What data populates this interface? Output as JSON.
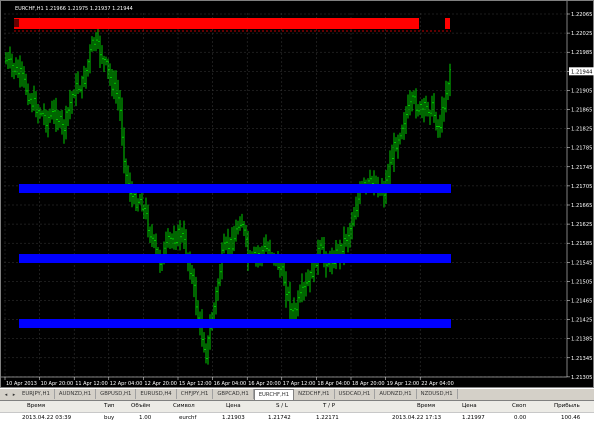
{
  "chart": {
    "title": "EURCHF,H1  1.21966 1.21975 1.21937 1.21944",
    "price_axis": [
      "1.22065",
      "1.22025",
      "1.21985",
      "1.21944",
      "1.21905",
      "1.21865",
      "1.21825",
      "1.21785",
      "1.21745",
      "1.21705",
      "1.21665",
      "1.21625",
      "1.21585",
      "1.21545",
      "1.21505",
      "1.21465",
      "1.21425",
      "1.21385",
      "1.21345",
      "1.21305"
    ],
    "current_price": "1.21944",
    "time_axis": [
      "10 Apr 2013",
      "10 Apr 20:00",
      "11 Apr 12:00",
      "12 Apr 04:00",
      "12 Apr 20:00",
      "15 Apr 12:00",
      "16 Apr 04:00",
      "16 Apr 20:00",
      "17 Apr 12:00",
      "18 Apr 04:00",
      "18 Apr 20:00",
      "19 Apr 12:00",
      "22 Apr 04:00"
    ],
    "colors": {
      "background": "#000000",
      "candles": "#00ff00",
      "grid": "#3a3a3a",
      "resistance": "#ff0000",
      "support": "#0000ff"
    }
  },
  "tabs": [
    "EURJPY,H1",
    "AUDNZD,H1",
    "GBPUSD,H1",
    "EURUSD,H4",
    "CHFJPY,H1",
    "GBPCAD,H1",
    "EURCHF,H1",
    "NZDCHF,H1",
    "USDCAD,H1",
    "AUDNZD,H1",
    "NZDUSD,H1"
  ],
  "active_tab": "EURCHF,H1",
  "terminal": {
    "headers": {
      "time": "Время",
      "type": "Тип",
      "volume": "Объём",
      "symbol": "Символ",
      "price": "Цена",
      "sl": "S / L",
      "tp": "T / P",
      "time2": "Время",
      "price2": "Цена",
      "swap": "Своп",
      "profit": "Прибыль"
    },
    "row": {
      "time": "2013.04.22 03:39",
      "type": "buy",
      "volume": "1.00",
      "symbol": "eurchf",
      "price": "1.21903",
      "sl": "1.21742",
      "tp": "1.22171",
      "time2": "2013.04.22 17:13",
      "price2": "1.21997",
      "swap": "0.00",
      "profit": "100.46"
    }
  }
}
